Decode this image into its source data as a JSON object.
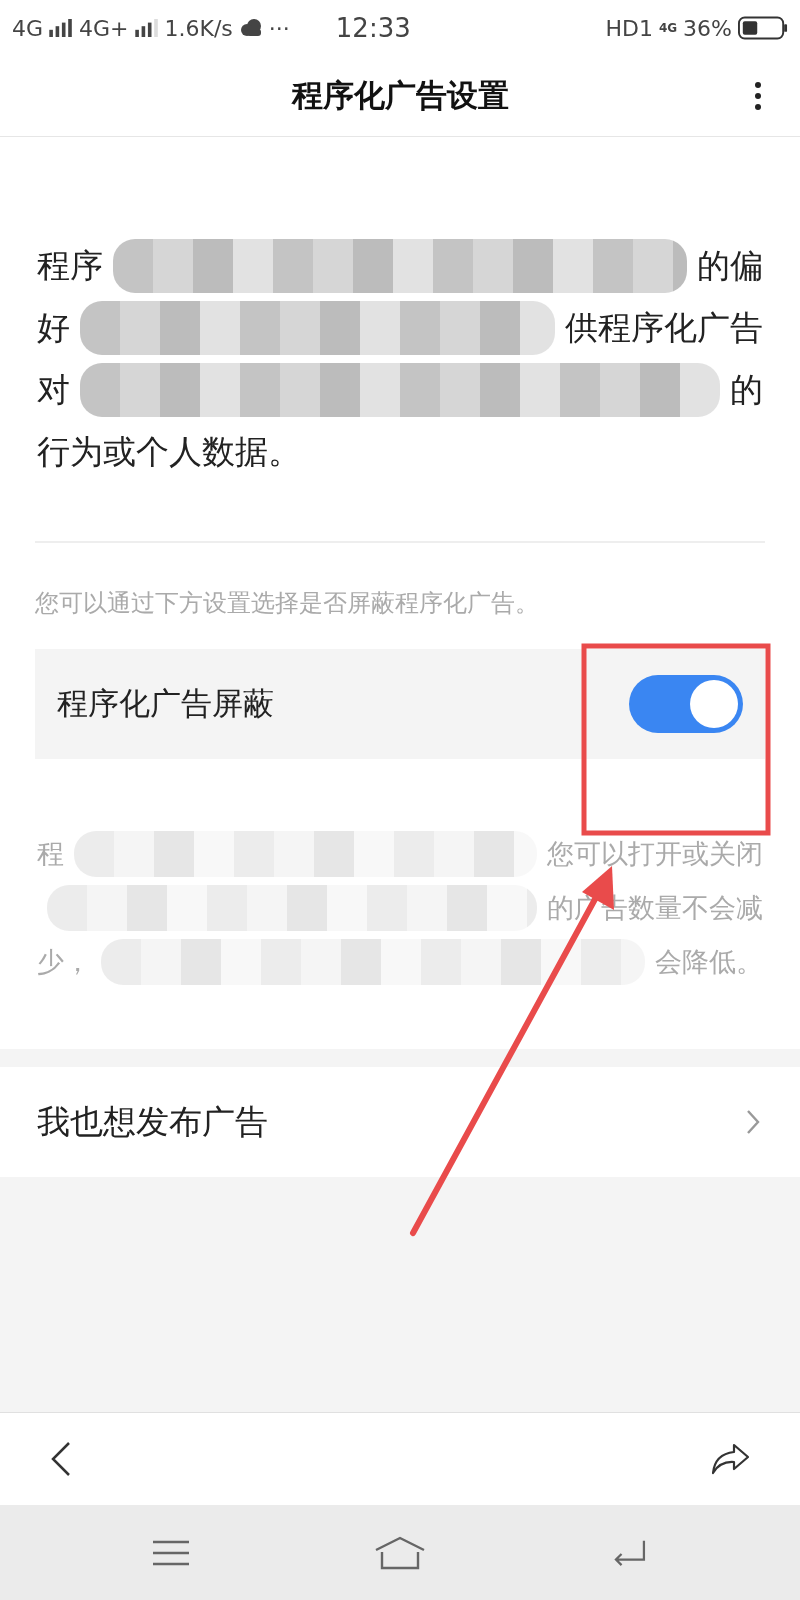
{
  "status_bar": {
    "network_1": "4G",
    "network_2": "4G+",
    "speed": "1.6K/s",
    "more": "···",
    "time": "12:33",
    "hd": "HD1",
    "network_3": "4G",
    "battery": "36%"
  },
  "header": {
    "title": "程序化广告设置"
  },
  "intro_lines": [
    {
      "left": "程序",
      "right": "的偏"
    },
    {
      "left": "好",
      "right": "供程序化广告"
    },
    {
      "left": "对",
      "right": "的"
    },
    {
      "left": "行为或个人数据。"
    }
  ],
  "hint": "您可以通过下方设置选择是否屏蔽程序化广告。",
  "toggle_row": {
    "label": "程序化广告屏蔽",
    "on": true
  },
  "note_lines": [
    {
      "left": "程",
      "right": "您可以打开或关闭"
    },
    {
      "right": "的广告数量不会减"
    },
    {
      "left": "少，",
      "right": "会降低。"
    }
  ],
  "link_row": {
    "label": "我也想发布广告"
  }
}
